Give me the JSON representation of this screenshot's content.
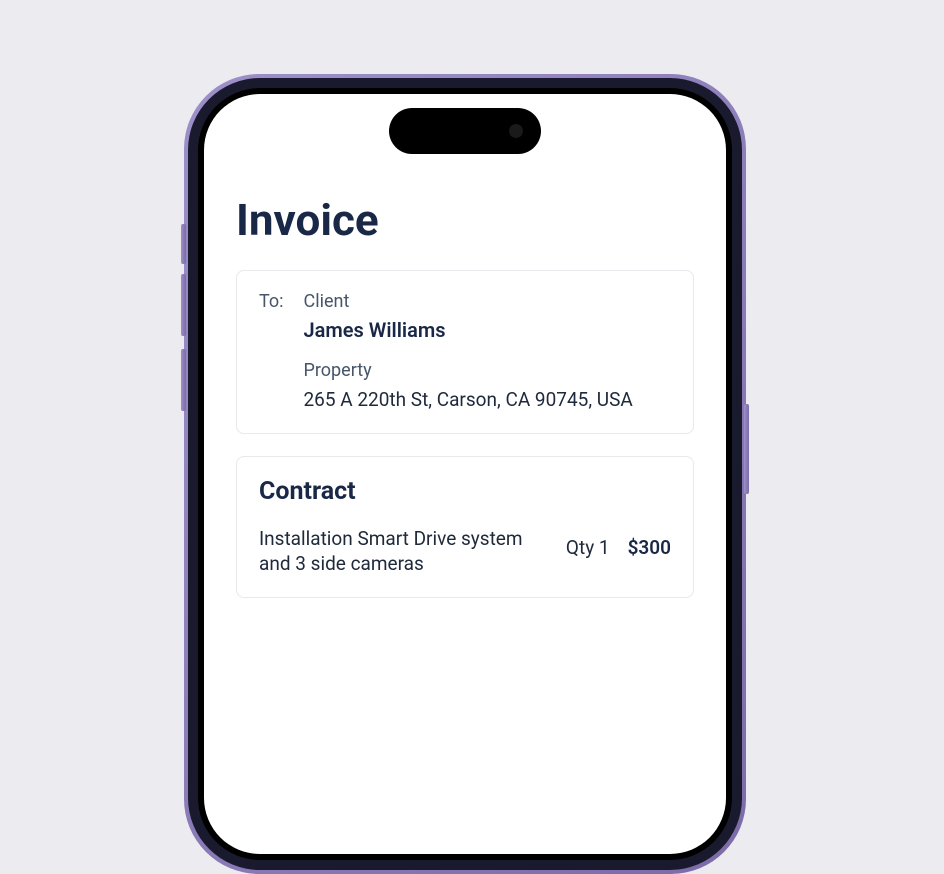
{
  "page": {
    "title": "Invoice"
  },
  "client": {
    "to_label": "To:",
    "client_label": "Client",
    "name": "James Williams",
    "property_label": "Property",
    "address": "265 A 220th St, Carson, CA 90745, USA"
  },
  "contract": {
    "title": "Contract",
    "items": [
      {
        "description": "Installation Smart Drive system and 3 side cameras",
        "qty_label": "Qty 1",
        "price": "$300"
      }
    ]
  }
}
